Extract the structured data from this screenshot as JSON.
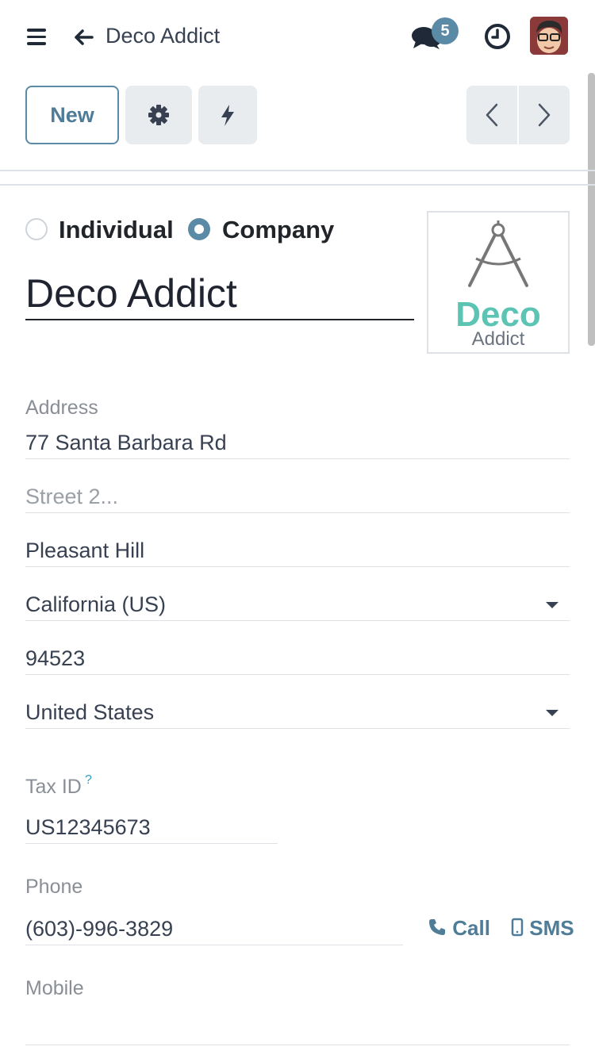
{
  "header": {
    "breadcrumb_title": "Deco Addict",
    "messages_count": "5",
    "icons": [
      "menu-icon",
      "back-arrow-icon",
      "chat-icon",
      "clock-icon",
      "user-avatar"
    ]
  },
  "toolbar": {
    "new_label": "New",
    "icons": [
      "gear-icon",
      "lightning-icon",
      "chevron-left-icon",
      "chevron-right-icon"
    ]
  },
  "company_type": {
    "options": [
      "Individual",
      "Company"
    ],
    "selected": "Company"
  },
  "partner": {
    "name": "Deco Addict",
    "logo": {
      "word_top": "Deco",
      "word_bottom": "Addict"
    }
  },
  "address": {
    "label": "Address",
    "street": "77 Santa Barbara Rd",
    "street2_placeholder": "Street 2...",
    "city": "Pleasant Hill",
    "state": "California (US)",
    "zip": "94523",
    "country": "United States"
  },
  "tax": {
    "label": "Tax ID",
    "help": "?",
    "value": "US12345673"
  },
  "phone": {
    "label": "Phone",
    "value": "(603)-996-3829",
    "call_label": "Call",
    "sms_label": "SMS"
  },
  "mobile": {
    "label": "Mobile",
    "value": ""
  },
  "colors": {
    "accent": "#5b8aa6",
    "logo_teal": "#5cc4b3",
    "help_blue": "#2aa0c5"
  }
}
